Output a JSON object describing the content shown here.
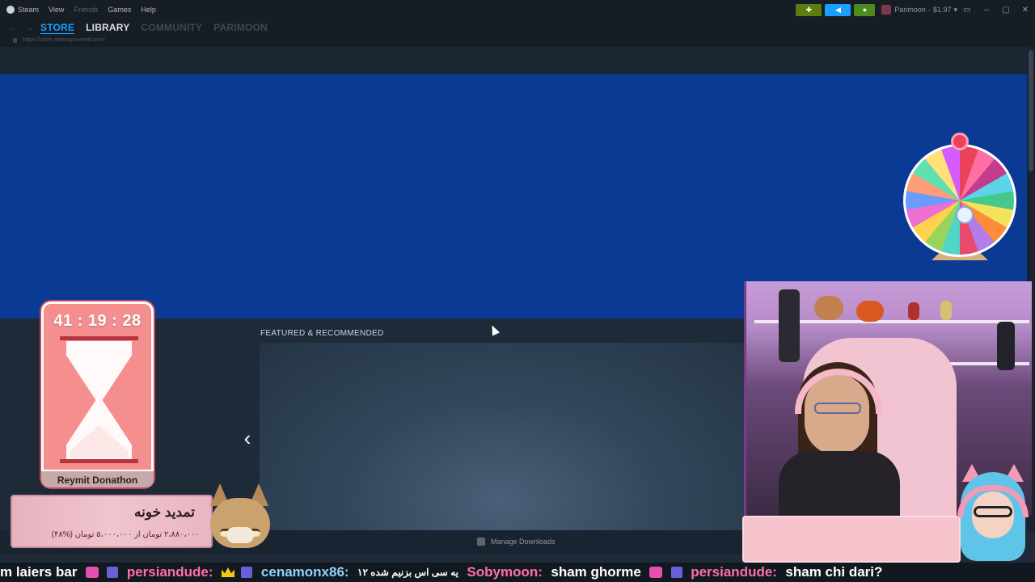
{
  "menubar": {
    "app": "Steam",
    "items": [
      "View",
      "Friends",
      "Games",
      "Help"
    ],
    "account_name": "Parimoon",
    "balance": "$1.97"
  },
  "nav": {
    "tabs": [
      "STORE",
      "LIBRARY",
      "COMMUNITY",
      "PARIMOON"
    ],
    "active": "STORE",
    "url": "https://store.steampowered.com/"
  },
  "store": {
    "featured_label": "FEATURED & RECOMMENDED",
    "manage_downloads": "Manage Downloads"
  },
  "overlay": {
    "timer": "41 : 19 : 28",
    "timer_title": "Reymit Donathon",
    "goal_title": "تمدید خونه",
    "goal_sub": "۲،۸۸۰،۰۰۰ تومان از ۵،۰۰۰،۰۰۰ تومان (%۴۸)"
  },
  "ticker": {
    "msg1_tail": "m laiers bar",
    "user1": "persiandude:",
    "user2": "cenamonx86:",
    "msg2": "یه سی اس بزنیم شده ۱۲",
    "user3": "Sobymoon:",
    "msg3": "sham ghorme",
    "user4": "persiandude:",
    "msg4": "sham chi dari?"
  },
  "colors": {
    "steam_blue": "#1a9fff",
    "hero_blue": "#0a3a94",
    "timer_pink": "#f58f8f"
  }
}
